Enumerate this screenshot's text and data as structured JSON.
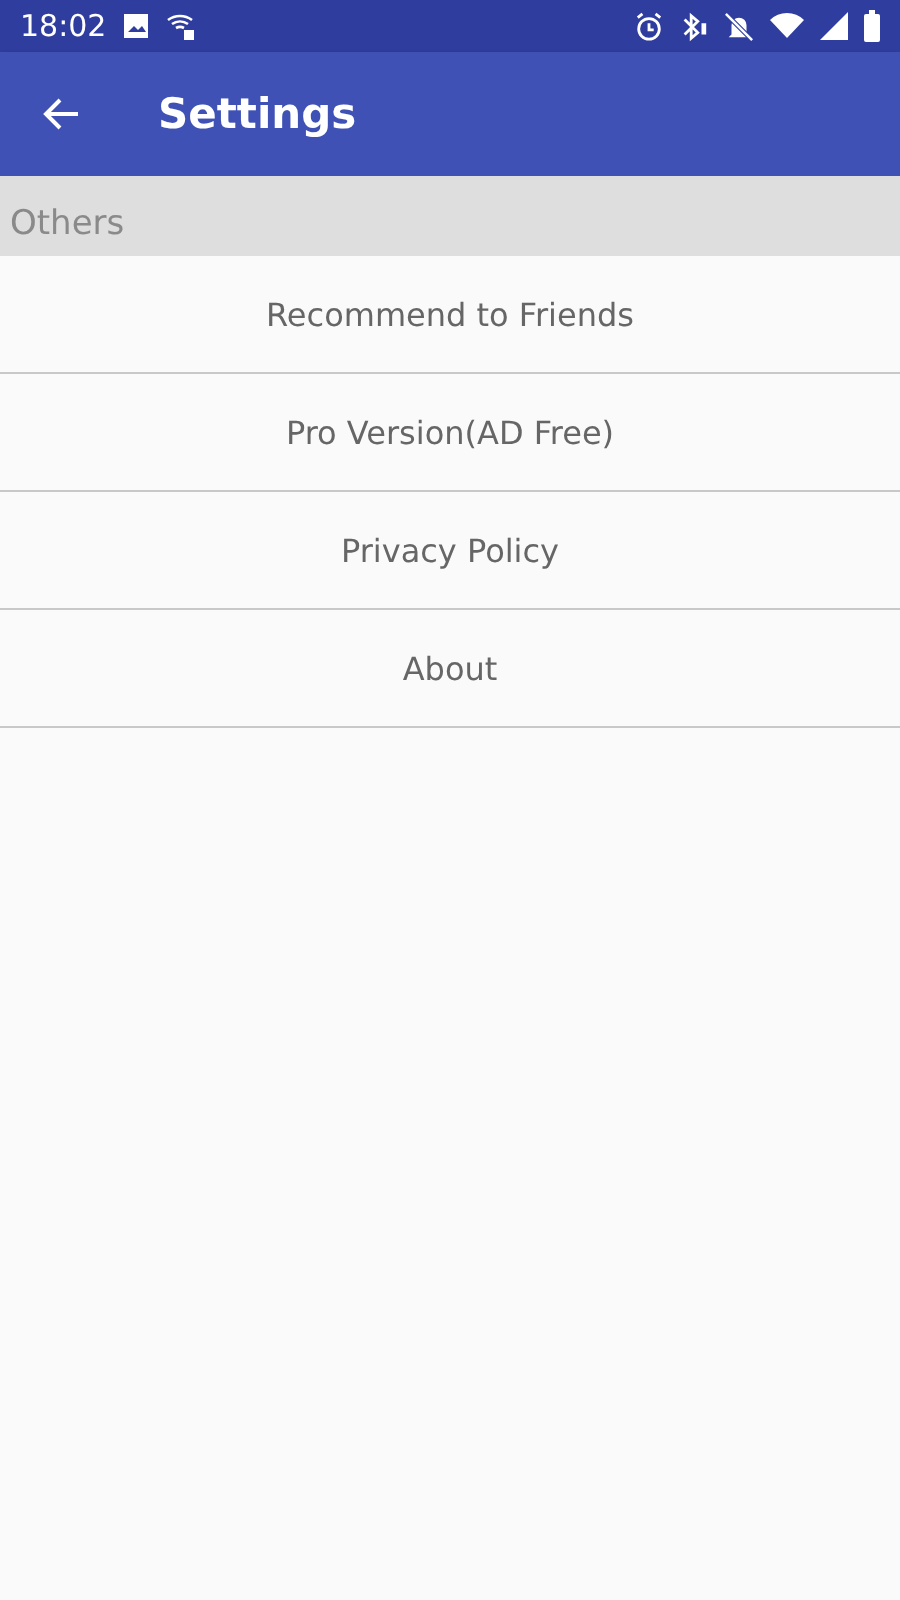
{
  "status_bar": {
    "time": "18:02"
  },
  "app_bar": {
    "title": "Settings"
  },
  "section": {
    "title": "Others"
  },
  "items": [
    {
      "label": "Recommend to Friends"
    },
    {
      "label": "Pro Version(AD Free)"
    },
    {
      "label": "Privacy Policy"
    },
    {
      "label": "About"
    }
  ]
}
